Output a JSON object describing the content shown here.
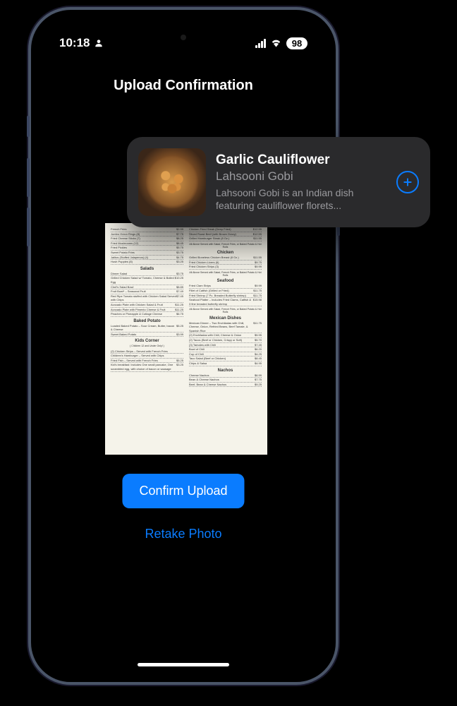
{
  "status_bar": {
    "time": "10:18",
    "battery": "98"
  },
  "page": {
    "title": "Upload Confirmation"
  },
  "actions": {
    "confirm": "Confirm Upload",
    "retake": "Retake Photo"
  },
  "card": {
    "title": "Garlic Cauliflower",
    "subtitle": "Lahsooni Gobi",
    "description": "Lahsooni Gobi is an Indian dish featuring cauliflower florets..."
  },
  "menu_preview": {
    "left_sections": [
      {
        "title": "",
        "items": [
          {
            "n": "French Fries",
            "p": "$2.99"
          },
          {
            "n": "Jumbo Onion Rings (8)",
            "p": "$7.75"
          },
          {
            "n": "Fried Cheese Sticks (7)",
            "p": "$8.25"
          },
          {
            "n": "Fried Mushrooms (12)",
            "p": "$8.45"
          },
          {
            "n": "Fried Pickles",
            "p": "$5.75"
          },
          {
            "n": "Sweet Potato Fries",
            "p": "$3.75"
          },
          {
            "n": "Jalitos (Stuffed Jalapenos) (4)",
            "p": "$4.75"
          },
          {
            "n": "Hush Puppies (8)",
            "p": "$3.25"
          }
        ]
      },
      {
        "title": "Salads",
        "items": [
          {
            "n": "Dinner Salad",
            "p": "$3.75"
          },
          {
            "n": "Grilled Chicken Salad w/ Tomato, Cheese & Boiled Egg",
            "p": "$10.25"
          },
          {
            "n": "Chef's Salad Bowl",
            "p": "$8.85"
          },
          {
            "n": "Fruit Bowl* – Seasonal Fruit",
            "p": "$7.49"
          },
          {
            "n": "Red Ripe Tomato stuffed with Chicken Salad Served with Chips",
            "p": "$7.45"
          },
          {
            "n": "Avocado Plate with Chicken Salad & Fruit",
            "p": "$11.25"
          },
          {
            "n": "Avocado Plate with Pimento Cheese & Fruit",
            "p": "$11.25"
          },
          {
            "n": "Peaches or Pineapple & Cottage Cheese",
            "p": "$6.75"
          }
        ]
      },
      {
        "title": "Baked Potato",
        "items": [
          {
            "n": "Loaded Baked Potato – Sour Cream, Butter, bacon & Cheese",
            "p": "$5.25"
          },
          {
            "n": "Sweet Baked Potato",
            "p": "$3.99"
          }
        ]
      },
      {
        "title": "Kids Corner",
        "note": "( Children 12 and Under Only! )",
        "items": [
          {
            "n": "(2) Chicken Strips – Served with French Fries",
            "p": ""
          },
          {
            "n": "Children's Hamburger – Served with Chips",
            "p": ""
          },
          {
            "n": "Fried Fish – Served with French Fries",
            "p": "$5.25"
          },
          {
            "n": "Kid's breakfast: Includes One small pancake, One scrambled egg, with choice of bacon or sausage",
            "p": "$3.25"
          }
        ]
      }
    ],
    "right_sections": [
      {
        "title": "",
        "items": [
          {
            "n": "Chicken Fried Steak (Deep Fried)",
            "p": "$12.55"
          },
          {
            "n": "Sliced Roast Beef (with Brown Gravy)",
            "p": "$12.55"
          },
          {
            "n": "Grilled Hamburger Steak (8 Oz.)",
            "p": "$11.55"
          }
        ],
        "note": "All Above Served with Salad, French Fries, or Baked Potato & Hot Rolls"
      },
      {
        "title": "Chicken",
        "items": [
          {
            "n": "Grilled Boneless Chicken Breast (8 Oz.)",
            "p": "$11.55"
          },
          {
            "n": "Fried Chicken Livers (6)",
            "p": "$9.75"
          },
          {
            "n": "Fried Chicken Strips (3)",
            "p": "$9.99"
          }
        ],
        "note": "All Above Served with Salad, French Fries, or Baked Potato & Hot Rolls"
      },
      {
        "title": "Seafood",
        "items": [
          {
            "n": "Fried Clam Strips",
            "p": "$9.99"
          },
          {
            "n": "Fillet of Catfish (Grilled or Fried)",
            "p": "$11.75"
          },
          {
            "n": "Fried Shrimp (7 Pc. Breaded Butterfly shrimp)",
            "p": "$11.75"
          },
          {
            "n": "Seafood Platter – Includes Fried Clams, Catfish & 3 fine breaded butterfly shrimp",
            "p": "$15.98"
          }
        ],
        "note": "All Above Served with Salad, French Fries, or Baked Potato & Hot Rolls"
      },
      {
        "title": "Mexican Dishes",
        "items": [
          {
            "n": "Mexican Dinner – Two Enchiladas with Chili, Cheese, Onion, Refried Beans, Beef Tamale, & Spanish Rice",
            "p": "$11.75"
          },
          {
            "n": "(2) Enchiladas with Chili, Cheese & Onion",
            "p": "$5.95"
          },
          {
            "n": "(2) Tacos (Beef or Chicken, Crispy or Soft)",
            "p": "$5.70"
          },
          {
            "n": "(3) Tamales with Chili",
            "p": "$7.45"
          },
          {
            "n": "Bowl of Chili",
            "p": "$6.20"
          },
          {
            "n": "Cup of Chili",
            "p": "$4.25"
          },
          {
            "n": "Taco Salad (Beef or Chicken)",
            "p": "$8.45"
          },
          {
            "n": "Chips & Salsa",
            "p": "$4.95"
          }
        ]
      },
      {
        "title": "Nachos",
        "items": [
          {
            "n": "Cheese Nachos",
            "p": "$6.99"
          },
          {
            "n": "Bean & Cheese Nachos",
            "p": "$7.75"
          },
          {
            "n": "Beef, Bean & Cheese Nachos",
            "p": "$9.25"
          }
        ]
      }
    ]
  }
}
